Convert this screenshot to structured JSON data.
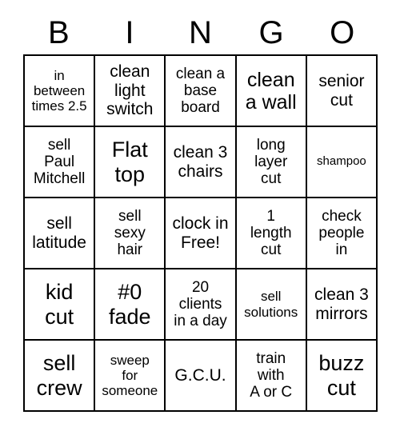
{
  "card": {
    "headers": [
      "B",
      "I",
      "N",
      "G",
      "O"
    ],
    "rows": [
      [
        {
          "text": "in\nbetween\ntimes 2.5",
          "size": "xs"
        },
        {
          "text": "clean\nlight\nswitch",
          "size": "md"
        },
        {
          "text": "clean a\nbase\nboard",
          "size": "sm"
        },
        {
          "text": "clean\na wall",
          "size": "lg"
        },
        {
          "text": "senior\ncut",
          "size": "md"
        }
      ],
      [
        {
          "text": "sell\nPaul\nMitchell",
          "size": "sm"
        },
        {
          "text": "Flat\ntop",
          "size": "xl"
        },
        {
          "text": "clean 3\nchairs",
          "size": "md"
        },
        {
          "text": "long\nlayer\ncut",
          "size": "sm"
        },
        {
          "text": "shampoo",
          "size": "xxs"
        }
      ],
      [
        {
          "text": "sell\nlatitude",
          "size": "md"
        },
        {
          "text": "sell\nsexy\nhair",
          "size": "sm"
        },
        {
          "text": "clock in\nFree!",
          "size": "md"
        },
        {
          "text": "1\nlength\ncut",
          "size": "sm"
        },
        {
          "text": "check\npeople\nin",
          "size": "sm"
        }
      ],
      [
        {
          "text": "kid\ncut",
          "size": "xl"
        },
        {
          "text": "#0\nfade",
          "size": "xl"
        },
        {
          "text": "20\nclients\nin a day",
          "size": "sm"
        },
        {
          "text": "sell\nsolutions",
          "size": "xs"
        },
        {
          "text": "clean 3\nmirrors",
          "size": "md"
        }
      ],
      [
        {
          "text": "sell\ncrew",
          "size": "xl"
        },
        {
          "text": "sweep\nfor\nsomeone",
          "size": "xs"
        },
        {
          "text": "G.C.U.",
          "size": "md"
        },
        {
          "text": "train\nwith\nA or C",
          "size": "sm"
        },
        {
          "text": "buzz\ncut",
          "size": "xl"
        }
      ]
    ]
  },
  "colors": {
    "border": "#000000",
    "background": "#ffffff",
    "text": "#000000"
  }
}
